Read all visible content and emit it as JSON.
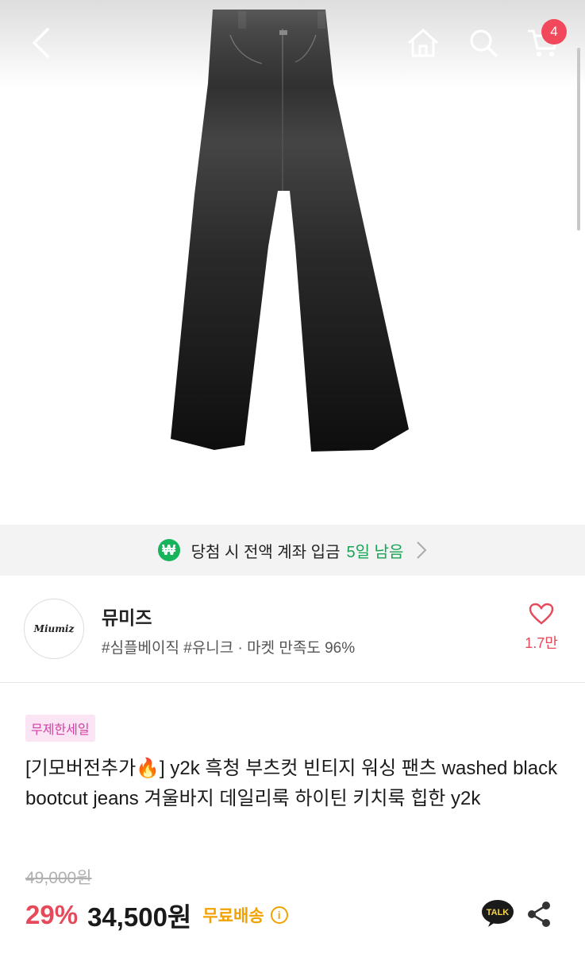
{
  "header": {
    "cart_count": "4",
    "icons": [
      "back-arrow-icon",
      "home-icon",
      "search-icon",
      "cart-icon"
    ]
  },
  "product_image": {
    "icon": "jeans-image"
  },
  "banner": {
    "icon_glyph": "₩",
    "text": "당첨 시 전액 계좌 입금",
    "days": "5일 남음",
    "accent_color": "#17a455"
  },
  "shop": {
    "logo_text": "Miumiz",
    "name": "뮤미즈",
    "tags": "#심플베이직 #유니크 · 마켓 만족도 96%",
    "likes": "1.7만"
  },
  "product": {
    "badge": "무제한세일",
    "title": "[기모버전추가🔥] y2k 흑청 부츠컷 빈티지 워싱 팬츠 washed black bootcut jeans 겨울바지 데일리룩 하이틴 키치룩 힙한 y2k",
    "original_price": "49,000원",
    "discount": "29%",
    "price": "34,500원",
    "shipping": "무료배송",
    "talk_label": "TALK",
    "accent_color": "#e5495a"
  }
}
